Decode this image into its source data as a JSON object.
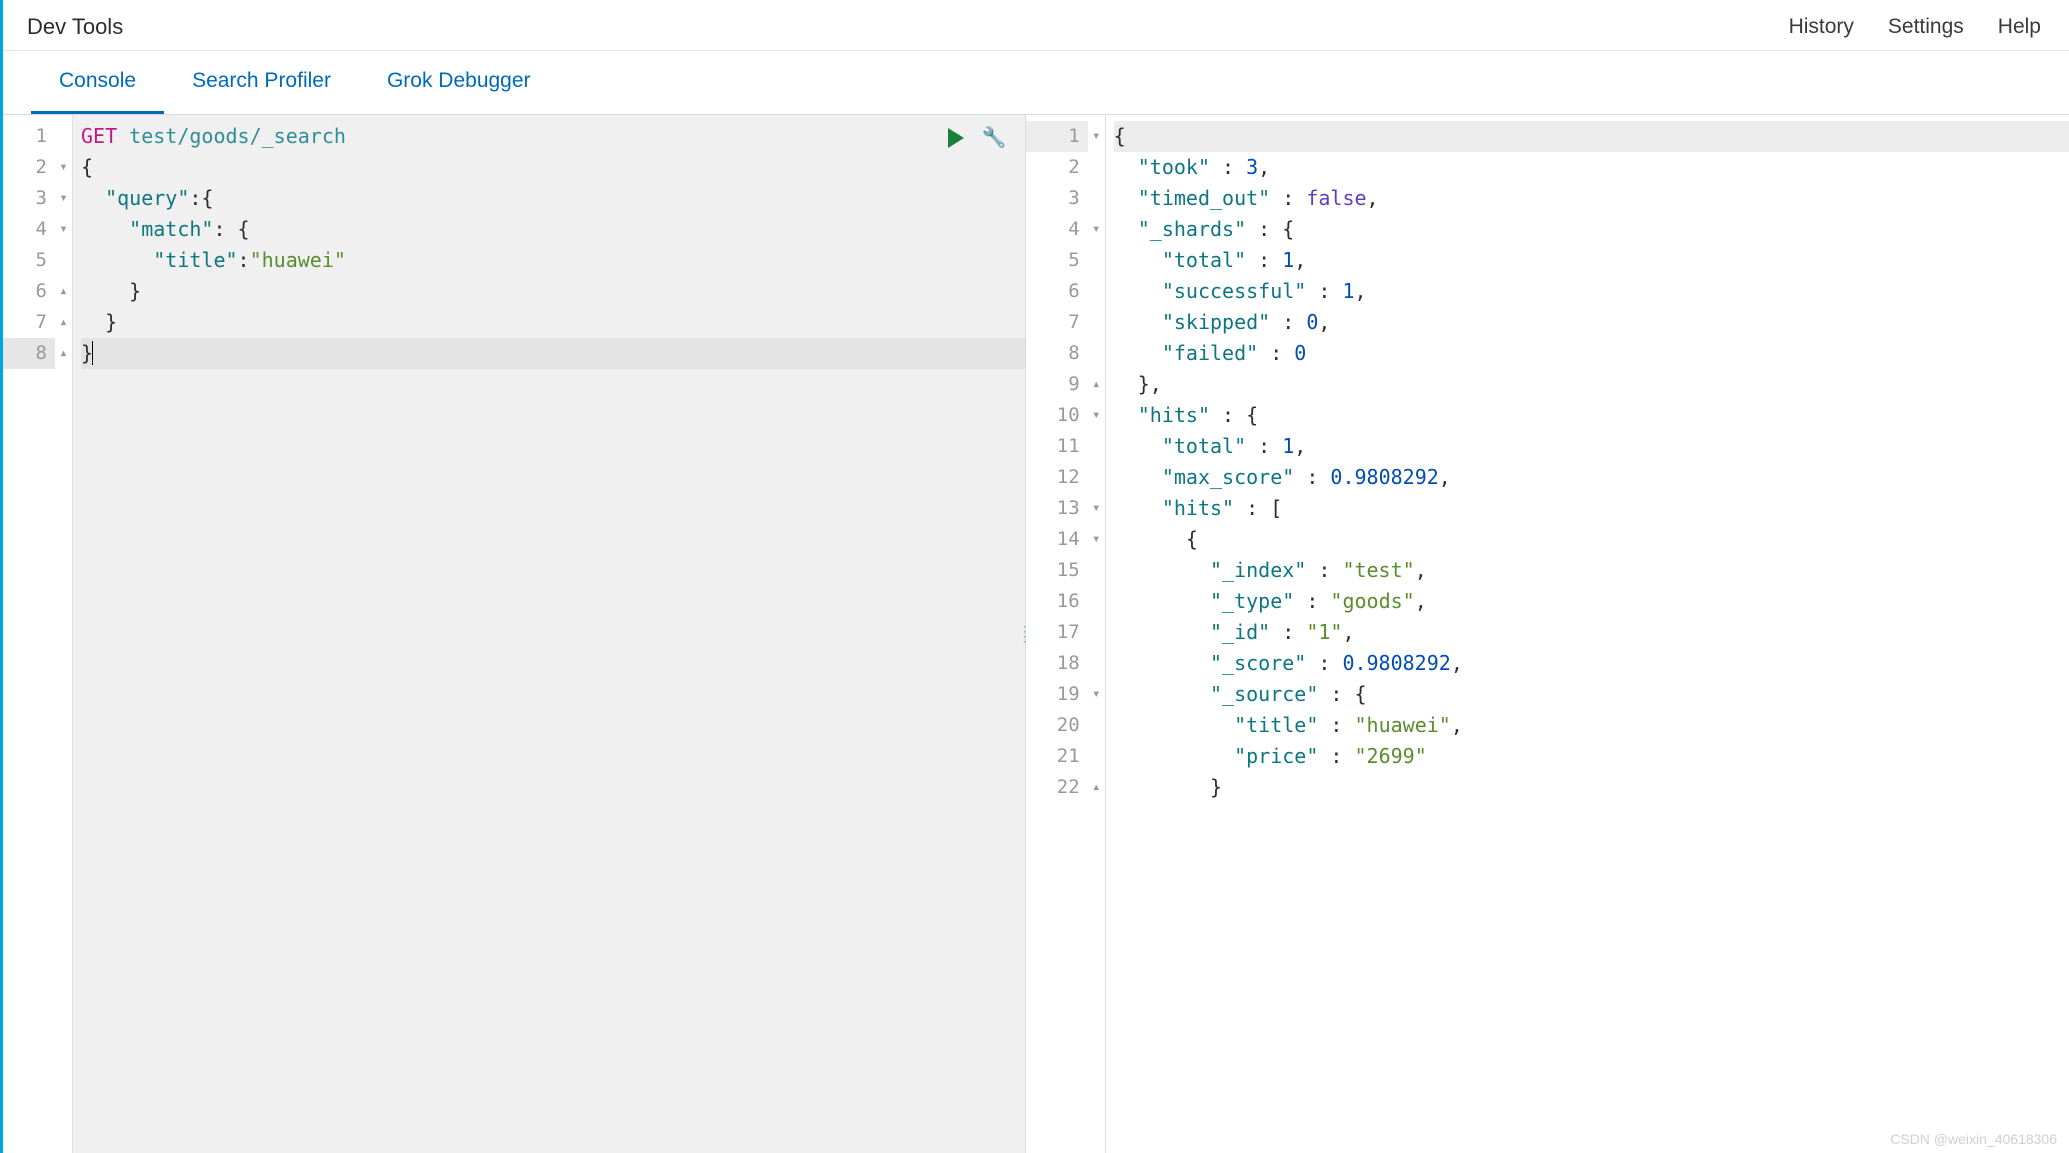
{
  "header": {
    "title": "Dev Tools",
    "links": [
      "History",
      "Settings",
      "Help"
    ]
  },
  "tabs": [
    "Console",
    "Search Profiler",
    "Grok Debugger"
  ],
  "active_tab_index": 0,
  "request": {
    "method": "GET",
    "path": "test/goods/_search",
    "lines": [
      {
        "n": 1,
        "fold": "",
        "tokens": [
          [
            "method",
            "GET"
          ],
          [
            "p",
            " "
          ],
          [
            "path",
            "test/goods/_search"
          ]
        ]
      },
      {
        "n": 2,
        "fold": "down",
        "tokens": [
          [
            "p",
            "{"
          ]
        ]
      },
      {
        "n": 3,
        "fold": "down",
        "tokens": [
          [
            "p",
            "  "
          ],
          [
            "key",
            "\"query\""
          ],
          [
            "p",
            ":{"
          ]
        ]
      },
      {
        "n": 4,
        "fold": "down",
        "tokens": [
          [
            "p",
            "    "
          ],
          [
            "key",
            "\"match\""
          ],
          [
            "p",
            ": {"
          ]
        ]
      },
      {
        "n": 5,
        "fold": "",
        "tokens": [
          [
            "p",
            "      "
          ],
          [
            "key",
            "\"title\""
          ],
          [
            "p",
            ":"
          ],
          [
            "str",
            "\"huawei\""
          ]
        ]
      },
      {
        "n": 6,
        "fold": "up",
        "tokens": [
          [
            "p",
            "    }"
          ]
        ]
      },
      {
        "n": 7,
        "fold": "up",
        "tokens": [
          [
            "p",
            "  }"
          ]
        ]
      },
      {
        "n": 8,
        "fold": "up",
        "tokens": [
          [
            "p",
            "}"
          ]
        ],
        "cursor": true,
        "active": true
      }
    ]
  },
  "response": {
    "lines": [
      {
        "n": 1,
        "fold": "down",
        "first": true,
        "tokens": [
          [
            "p",
            "{"
          ]
        ]
      },
      {
        "n": 2,
        "fold": "",
        "tokens": [
          [
            "p",
            "  "
          ],
          [
            "key",
            "\"took\""
          ],
          [
            "p",
            " : "
          ],
          [
            "num",
            "3"
          ],
          [
            "p",
            ","
          ]
        ]
      },
      {
        "n": 3,
        "fold": "",
        "tokens": [
          [
            "p",
            "  "
          ],
          [
            "key",
            "\"timed_out\""
          ],
          [
            "p",
            " : "
          ],
          [
            "bool",
            "false"
          ],
          [
            "p",
            ","
          ]
        ]
      },
      {
        "n": 4,
        "fold": "down",
        "tokens": [
          [
            "p",
            "  "
          ],
          [
            "key",
            "\"_shards\""
          ],
          [
            "p",
            " : {"
          ]
        ]
      },
      {
        "n": 5,
        "fold": "",
        "tokens": [
          [
            "p",
            "    "
          ],
          [
            "key",
            "\"total\""
          ],
          [
            "p",
            " : "
          ],
          [
            "num",
            "1"
          ],
          [
            "p",
            ","
          ]
        ]
      },
      {
        "n": 6,
        "fold": "",
        "tokens": [
          [
            "p",
            "    "
          ],
          [
            "key",
            "\"successful\""
          ],
          [
            "p",
            " : "
          ],
          [
            "num",
            "1"
          ],
          [
            "p",
            ","
          ]
        ]
      },
      {
        "n": 7,
        "fold": "",
        "tokens": [
          [
            "p",
            "    "
          ],
          [
            "key",
            "\"skipped\""
          ],
          [
            "p",
            " : "
          ],
          [
            "num",
            "0"
          ],
          [
            "p",
            ","
          ]
        ]
      },
      {
        "n": 8,
        "fold": "",
        "tokens": [
          [
            "p",
            "    "
          ],
          [
            "key",
            "\"failed\""
          ],
          [
            "p",
            " : "
          ],
          [
            "num",
            "0"
          ]
        ]
      },
      {
        "n": 9,
        "fold": "up",
        "tokens": [
          [
            "p",
            "  },"
          ]
        ]
      },
      {
        "n": 10,
        "fold": "down",
        "tokens": [
          [
            "p",
            "  "
          ],
          [
            "key",
            "\"hits\""
          ],
          [
            "p",
            " : {"
          ]
        ]
      },
      {
        "n": 11,
        "fold": "",
        "tokens": [
          [
            "p",
            "    "
          ],
          [
            "key",
            "\"total\""
          ],
          [
            "p",
            " : "
          ],
          [
            "num",
            "1"
          ],
          [
            "p",
            ","
          ]
        ]
      },
      {
        "n": 12,
        "fold": "",
        "tokens": [
          [
            "p",
            "    "
          ],
          [
            "key",
            "\"max_score\""
          ],
          [
            "p",
            " : "
          ],
          [
            "num",
            "0.9808292"
          ],
          [
            "p",
            ","
          ]
        ]
      },
      {
        "n": 13,
        "fold": "down",
        "tokens": [
          [
            "p",
            "    "
          ],
          [
            "key",
            "\"hits\""
          ],
          [
            "p",
            " : ["
          ]
        ]
      },
      {
        "n": 14,
        "fold": "down",
        "tokens": [
          [
            "p",
            "      {"
          ]
        ]
      },
      {
        "n": 15,
        "fold": "",
        "tokens": [
          [
            "p",
            "        "
          ],
          [
            "key",
            "\"_index\""
          ],
          [
            "p",
            " : "
          ],
          [
            "str",
            "\"test\""
          ],
          [
            "p",
            ","
          ]
        ]
      },
      {
        "n": 16,
        "fold": "",
        "tokens": [
          [
            "p",
            "        "
          ],
          [
            "key",
            "\"_type\""
          ],
          [
            "p",
            " : "
          ],
          [
            "str",
            "\"goods\""
          ],
          [
            "p",
            ","
          ]
        ]
      },
      {
        "n": 17,
        "fold": "",
        "tokens": [
          [
            "p",
            "        "
          ],
          [
            "key",
            "\"_id\""
          ],
          [
            "p",
            " : "
          ],
          [
            "str",
            "\"1\""
          ],
          [
            "p",
            ","
          ]
        ]
      },
      {
        "n": 18,
        "fold": "",
        "tokens": [
          [
            "p",
            "        "
          ],
          [
            "key",
            "\"_score\""
          ],
          [
            "p",
            " : "
          ],
          [
            "num",
            "0.9808292"
          ],
          [
            "p",
            ","
          ]
        ]
      },
      {
        "n": 19,
        "fold": "down",
        "tokens": [
          [
            "p",
            "        "
          ],
          [
            "key",
            "\"_source\""
          ],
          [
            "p",
            " : {"
          ]
        ]
      },
      {
        "n": 20,
        "fold": "",
        "tokens": [
          [
            "p",
            "          "
          ],
          [
            "key",
            "\"title\""
          ],
          [
            "p",
            " : "
          ],
          [
            "str",
            "\"huawei\""
          ],
          [
            "p",
            ","
          ]
        ]
      },
      {
        "n": 21,
        "fold": "",
        "tokens": [
          [
            "p",
            "          "
          ],
          [
            "key",
            "\"price\""
          ],
          [
            "p",
            " : "
          ],
          [
            "str",
            "\"2699\""
          ]
        ]
      },
      {
        "n": 22,
        "fold": "up",
        "tokens": [
          [
            "p",
            "        }"
          ]
        ]
      }
    ]
  },
  "watermark": "CSDN @weixin_40618306"
}
